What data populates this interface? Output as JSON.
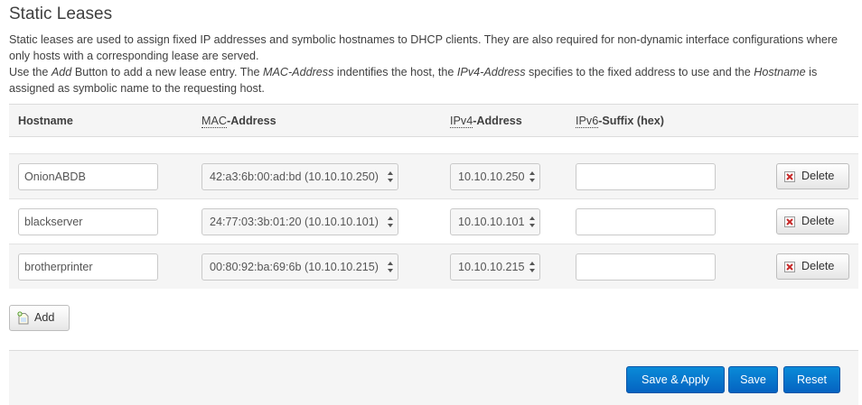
{
  "section": {
    "title": "Static Leases",
    "desc_line1": "Static leases are used to assign fixed IP addresses and symbolic hostnames to DHCP clients. They are also required for non-dynamic interface configurations where only hosts with a corresponding lease are served.",
    "desc_line2": {
      "p1": "Use the ",
      "add_em": "Add",
      "p2": " Button to add a new lease entry. The ",
      "mac_em": "MAC-Address",
      "p3": " indentifies the host, the ",
      "ipv4_em": "IPv4-Address",
      "p4": " specifies to the fixed address to use and the ",
      "host_em": "Hostname",
      "p5": " is assigned as symbolic name to the requesting host."
    }
  },
  "table": {
    "headers": {
      "hostname": "Hostname",
      "mac_abbr": "MAC",
      "mac_rest": "-Address",
      "ipv4_abbr": "IPv4",
      "ipv4_rest": "-Address",
      "ipv6_abbr": "IPv6",
      "ipv6_rest": "-Suffix (hex)"
    },
    "rows": [
      {
        "hostname": "OnionABDB",
        "mac": "42:a3:6b:00:ad:bd (10.10.10.250)",
        "ipv4": "10.10.10.250",
        "ipv6": "",
        "delete_label": "Delete"
      },
      {
        "hostname": "blackserver",
        "mac": "24:77:03:3b:01:20 (10.10.10.101)",
        "ipv4": "10.10.10.101",
        "ipv6": "",
        "delete_label": "Delete"
      },
      {
        "hostname": "brotherprinter",
        "mac": "00:80:92:ba:69:6b (10.10.10.215)",
        "ipv4": "10.10.10.215",
        "ipv6": "",
        "delete_label": "Delete"
      }
    ]
  },
  "actions": {
    "add_label": "Add",
    "save_apply_label": "Save & Apply",
    "save_label": "Save",
    "reset_label": "Reset"
  },
  "colors": {
    "primary_button": "#0563c1",
    "delete_icon": "#c62828"
  }
}
